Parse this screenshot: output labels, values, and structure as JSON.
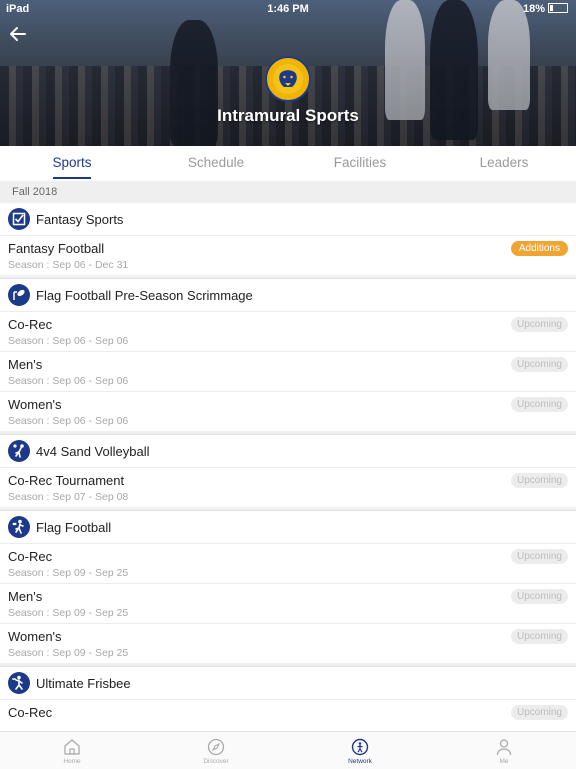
{
  "status": {
    "device": "iPad",
    "time": "1:46 PM",
    "battery": "18%"
  },
  "header": {
    "title": "Intramural Sports",
    "back_icon": "back-arrow-icon",
    "logo_icon": "lion-logo-icon"
  },
  "tabs": [
    {
      "label": "Sports",
      "active": true
    },
    {
      "label": "Schedule",
      "active": false
    },
    {
      "label": "Facilities",
      "active": false
    },
    {
      "label": "Leaders",
      "active": false
    }
  ],
  "season_label": "Fall 2018",
  "groups": [
    {
      "title": "Fantasy Sports",
      "icon": "checkbox-icon",
      "items": [
        {
          "name": "Fantasy Football",
          "season": "Season : Sep 06 - Dec 31",
          "badge": "Additions"
        }
      ]
    },
    {
      "title": "Flag Football Pre-Season Scrimmage",
      "icon": "football-icon",
      "items": [
        {
          "name": "Co-Rec",
          "season": "Season : Sep 06 - Sep 06",
          "badge": "Upcoming"
        },
        {
          "name": "Men's",
          "season": "Season : Sep 06 - Sep 06",
          "badge": "Upcoming"
        },
        {
          "name": "Women's",
          "season": "Season : Sep 06 - Sep 06",
          "badge": "Upcoming"
        }
      ]
    },
    {
      "title": "4v4 Sand Volleyball",
      "icon": "volleyball-player-icon",
      "items": [
        {
          "name": "Co-Rec Tournament",
          "season": "Season : Sep 07 - Sep 08",
          "badge": "Upcoming"
        }
      ]
    },
    {
      "title": "Flag Football",
      "icon": "football-player-icon",
      "items": [
        {
          "name": "Co-Rec",
          "season": "Season : Sep 09 - Sep 25",
          "badge": "Upcoming"
        },
        {
          "name": "Men's",
          "season": "Season : Sep 09 - Sep 25",
          "badge": "Upcoming"
        },
        {
          "name": "Women's",
          "season": "Season : Sep 09 - Sep 25",
          "badge": "Upcoming"
        }
      ]
    },
    {
      "title": "Ultimate Frisbee",
      "icon": "frisbee-player-icon",
      "items": [
        {
          "name": "Co-Rec",
          "season": "",
          "badge": "Upcoming"
        }
      ]
    }
  ],
  "bottom_nav": [
    {
      "label": "Home",
      "icon": "home-icon",
      "active": false
    },
    {
      "label": "Discover",
      "icon": "compass-icon",
      "active": false
    },
    {
      "label": "Network",
      "icon": "network-icon",
      "active": true
    },
    {
      "label": "Me",
      "icon": "person-icon",
      "active": false
    }
  ],
  "colors": {
    "primary": "#1d3a8a",
    "additions_badge": "#f0a532",
    "upcoming_badge": "#ececec"
  }
}
